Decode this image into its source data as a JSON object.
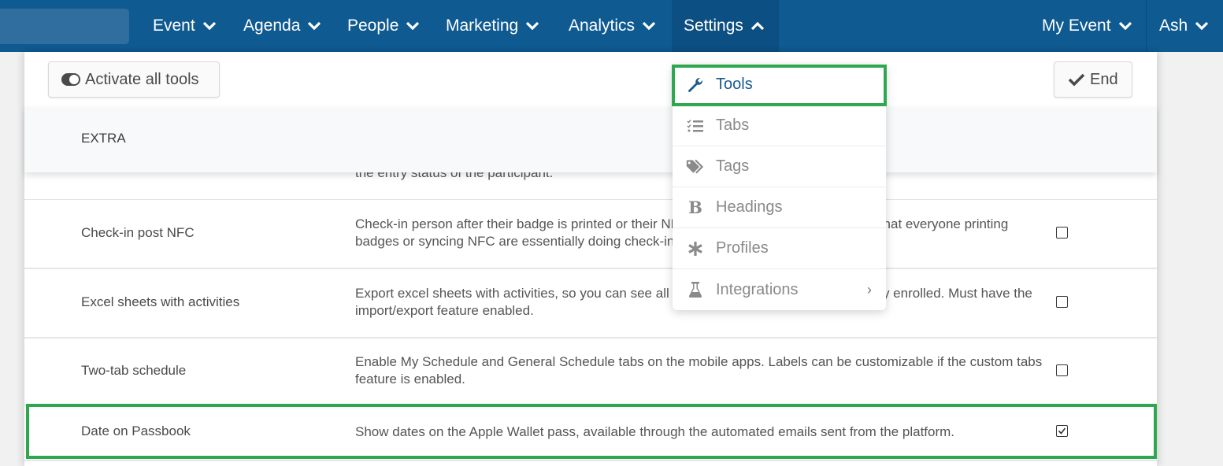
{
  "nav": {
    "items": [
      {
        "label": "Event",
        "state": "collapsed"
      },
      {
        "label": "Agenda",
        "state": "collapsed"
      },
      {
        "label": "People",
        "state": "collapsed"
      },
      {
        "label": "Marketing",
        "state": "collapsed"
      },
      {
        "label": "Analytics",
        "state": "collapsed"
      },
      {
        "label": "Settings",
        "state": "expanded"
      }
    ],
    "event_selector": "My Event",
    "user": "Ash"
  },
  "toolbar": {
    "activate_label": "Activate all tools",
    "end_label": "End"
  },
  "settings_menu": {
    "items": [
      {
        "label": "Tools",
        "icon": "wrench-icon",
        "active": true
      },
      {
        "label": "Tabs",
        "icon": "list-check-icon"
      },
      {
        "label": "Tags",
        "icon": "tags-icon"
      },
      {
        "label": "Headings",
        "icon": "bold-icon"
      },
      {
        "label": "Profiles",
        "icon": "asterisk-icon"
      },
      {
        "label": "Integrations",
        "icon": "flask-icon",
        "has_submenu": true
      }
    ]
  },
  "section": {
    "title": "EXTRA",
    "partial_row_text": "the entry status of the participant.",
    "rows": [
      {
        "name": "Check-in post NFC",
        "description": "Check-in person after their badge is printed or their NFC is synced. This option prevents that everyone printing badges or syncing NFC are essentially doing check-in.",
        "checked": false
      },
      {
        "name": "Excel sheets with activities",
        "description": "Export excel sheets with activities, so you can see all the activities an attendee is currently enrolled. Must have the import/export feature enabled.",
        "checked": false
      },
      {
        "name": "Two-tab schedule",
        "description": "Enable My Schedule and General Schedule tabs on the mobile apps. Labels can be customizable if the custom tabs feature is enabled.",
        "checked": false
      },
      {
        "name": "Date on Passbook",
        "description": "Show dates on the Apple Wallet pass, available through the automated emails sent from the platform.",
        "checked": true
      }
    ]
  },
  "colors": {
    "nav_bg": "#0f5a91",
    "highlight": "#2ea84f",
    "active_menu": "#1a5b8e"
  }
}
